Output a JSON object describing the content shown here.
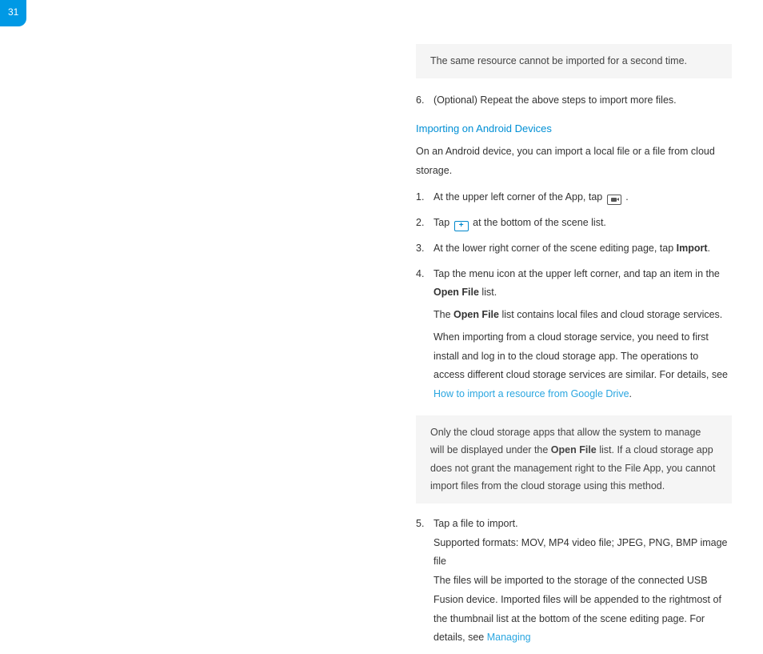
{
  "page_number": "31",
  "note1": "The same resource cannot be imported for a second time.",
  "step6_num": "6.",
  "step6_text": "(Optional) Repeat the above steps to import more files.",
  "section_title": "Importing on Android Devices",
  "intro": "On an Android device, you can import a local file or a file from cloud storage.",
  "s1_num": "1.",
  "s1_pre": "At the upper left corner of the App, tap ",
  "s1_post": " .",
  "s2_num": "2.",
  "s2_pre": "Tap ",
  "s2_post": " at the bottom of the scene list.",
  "s3_num": "3.",
  "s3_pre": "At the lower right corner of the scene editing page, tap ",
  "s3_bold": "Import",
  "s3_post": ".",
  "s4_num": "4.",
  "s4_pre": "Tap the menu icon at the upper left corner, and tap an item in the ",
  "s4_bold1": "Open File",
  "s4_mid1": " list.",
  "s4_line2a": "The ",
  "s4_bold2": "Open File",
  "s4_line2b": " list contains local files and cloud storage services.",
  "s4_line3": "When importing from a cloud storage service, you need to first install and log in to the cloud storage app. The operations to access different cloud storage services are similar. For details, see ",
  "s4_link": "How to import a resource from Google Drive",
  "s4_post": ".",
  "note2_a": "Only the cloud storage apps that allow the system to manage will be displayed under the ",
  "note2_bold": "Open File",
  "note2_b": " list. If a cloud storage app does not grant the management right to the File App, you cannot import files from the cloud storage using this method.",
  "s5_num": "5.",
  "s5_line1": "Tap a file to import.",
  "s5_line2": "Supported formats: MOV, MP4 video file; JPEG, PNG, BMP image file",
  "s5_line3": "The files will be imported to the storage of the connected USB Fusion device. Imported files will be appended to the rightmost of the thumbnail list at the bottom of the scene editing page. For details, see ",
  "s5_link": "Managing"
}
